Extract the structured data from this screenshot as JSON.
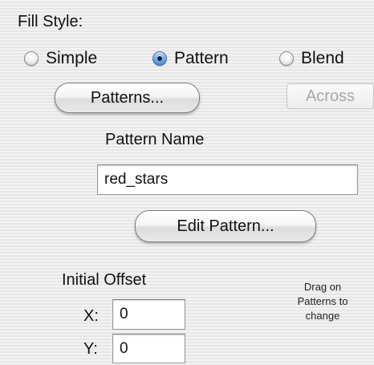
{
  "fill_style": {
    "label": "Fill Style:",
    "options": [
      {
        "label": "Simple",
        "selected": false
      },
      {
        "label": "Pattern",
        "selected": true
      },
      {
        "label": "Blend",
        "selected": false
      }
    ]
  },
  "buttons": {
    "patterns": "Patterns...",
    "across": "Across",
    "edit_pattern": "Edit Pattern..."
  },
  "pattern_name": {
    "label": "Pattern Name",
    "value": "red_stars"
  },
  "initial_offset": {
    "label": "Initial Offset",
    "x_label": "X:",
    "x_value": "0",
    "y_label": "Y:",
    "y_value": "0"
  },
  "hint": {
    "line1": "Drag on",
    "line2": "Patterns to",
    "line3": "change"
  },
  "colors": {
    "radio_selected": "#2f6fc6",
    "disabled_text": "#a9a9a9"
  }
}
